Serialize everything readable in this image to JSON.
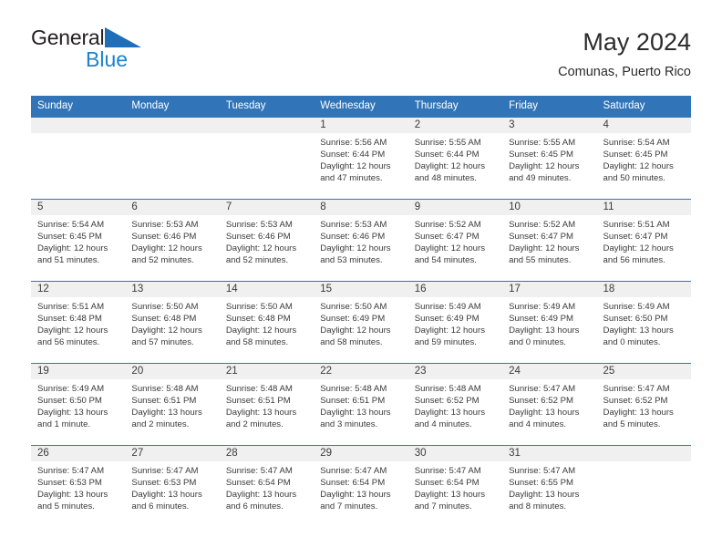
{
  "brand": {
    "name_top": "General",
    "name_bottom": "Blue",
    "triangle_color": "#1e6fb8",
    "text_color": "#231f20",
    "blue_color": "#2181c9"
  },
  "header": {
    "title": "May 2024",
    "subtitle": "Comunas, Puerto Rico"
  },
  "theme": {
    "header_blue": "#3175b8",
    "day_band_gray": "#f0f0f0",
    "text": "#3a3a3a"
  },
  "weekdays": [
    "Sunday",
    "Monday",
    "Tuesday",
    "Wednesday",
    "Thursday",
    "Friday",
    "Saturday"
  ],
  "weeks": [
    [
      {
        "day": "",
        "sunrise": "",
        "sunset": "",
        "daylight_line1": "",
        "daylight_line2": ""
      },
      {
        "day": "",
        "sunrise": "",
        "sunset": "",
        "daylight_line1": "",
        "daylight_line2": ""
      },
      {
        "day": "",
        "sunrise": "",
        "sunset": "",
        "daylight_line1": "",
        "daylight_line2": ""
      },
      {
        "day": "1",
        "sunrise": "Sunrise: 5:56 AM",
        "sunset": "Sunset: 6:44 PM",
        "daylight_line1": "Daylight: 12 hours",
        "daylight_line2": "and 47 minutes."
      },
      {
        "day": "2",
        "sunrise": "Sunrise: 5:55 AM",
        "sunset": "Sunset: 6:44 PM",
        "daylight_line1": "Daylight: 12 hours",
        "daylight_line2": "and 48 minutes."
      },
      {
        "day": "3",
        "sunrise": "Sunrise: 5:55 AM",
        "sunset": "Sunset: 6:45 PM",
        "daylight_line1": "Daylight: 12 hours",
        "daylight_line2": "and 49 minutes."
      },
      {
        "day": "4",
        "sunrise": "Sunrise: 5:54 AM",
        "sunset": "Sunset: 6:45 PM",
        "daylight_line1": "Daylight: 12 hours",
        "daylight_line2": "and 50 minutes."
      }
    ],
    [
      {
        "day": "5",
        "sunrise": "Sunrise: 5:54 AM",
        "sunset": "Sunset: 6:45 PM",
        "daylight_line1": "Daylight: 12 hours",
        "daylight_line2": "and 51 minutes."
      },
      {
        "day": "6",
        "sunrise": "Sunrise: 5:53 AM",
        "sunset": "Sunset: 6:46 PM",
        "daylight_line1": "Daylight: 12 hours",
        "daylight_line2": "and 52 minutes."
      },
      {
        "day": "7",
        "sunrise": "Sunrise: 5:53 AM",
        "sunset": "Sunset: 6:46 PM",
        "daylight_line1": "Daylight: 12 hours",
        "daylight_line2": "and 52 minutes."
      },
      {
        "day": "8",
        "sunrise": "Sunrise: 5:53 AM",
        "sunset": "Sunset: 6:46 PM",
        "daylight_line1": "Daylight: 12 hours",
        "daylight_line2": "and 53 minutes."
      },
      {
        "day": "9",
        "sunrise": "Sunrise: 5:52 AM",
        "sunset": "Sunset: 6:47 PM",
        "daylight_line1": "Daylight: 12 hours",
        "daylight_line2": "and 54 minutes."
      },
      {
        "day": "10",
        "sunrise": "Sunrise: 5:52 AM",
        "sunset": "Sunset: 6:47 PM",
        "daylight_line1": "Daylight: 12 hours",
        "daylight_line2": "and 55 minutes."
      },
      {
        "day": "11",
        "sunrise": "Sunrise: 5:51 AM",
        "sunset": "Sunset: 6:47 PM",
        "daylight_line1": "Daylight: 12 hours",
        "daylight_line2": "and 56 minutes."
      }
    ],
    [
      {
        "day": "12",
        "sunrise": "Sunrise: 5:51 AM",
        "sunset": "Sunset: 6:48 PM",
        "daylight_line1": "Daylight: 12 hours",
        "daylight_line2": "and 56 minutes."
      },
      {
        "day": "13",
        "sunrise": "Sunrise: 5:50 AM",
        "sunset": "Sunset: 6:48 PM",
        "daylight_line1": "Daylight: 12 hours",
        "daylight_line2": "and 57 minutes."
      },
      {
        "day": "14",
        "sunrise": "Sunrise: 5:50 AM",
        "sunset": "Sunset: 6:48 PM",
        "daylight_line1": "Daylight: 12 hours",
        "daylight_line2": "and 58 minutes."
      },
      {
        "day": "15",
        "sunrise": "Sunrise: 5:50 AM",
        "sunset": "Sunset: 6:49 PM",
        "daylight_line1": "Daylight: 12 hours",
        "daylight_line2": "and 58 minutes."
      },
      {
        "day": "16",
        "sunrise": "Sunrise: 5:49 AM",
        "sunset": "Sunset: 6:49 PM",
        "daylight_line1": "Daylight: 12 hours",
        "daylight_line2": "and 59 minutes."
      },
      {
        "day": "17",
        "sunrise": "Sunrise: 5:49 AM",
        "sunset": "Sunset: 6:49 PM",
        "daylight_line1": "Daylight: 13 hours",
        "daylight_line2": "and 0 minutes."
      },
      {
        "day": "18",
        "sunrise": "Sunrise: 5:49 AM",
        "sunset": "Sunset: 6:50 PM",
        "daylight_line1": "Daylight: 13 hours",
        "daylight_line2": "and 0 minutes."
      }
    ],
    [
      {
        "day": "19",
        "sunrise": "Sunrise: 5:49 AM",
        "sunset": "Sunset: 6:50 PM",
        "daylight_line1": "Daylight: 13 hours",
        "daylight_line2": "and 1 minute."
      },
      {
        "day": "20",
        "sunrise": "Sunrise: 5:48 AM",
        "sunset": "Sunset: 6:51 PM",
        "daylight_line1": "Daylight: 13 hours",
        "daylight_line2": "and 2 minutes."
      },
      {
        "day": "21",
        "sunrise": "Sunrise: 5:48 AM",
        "sunset": "Sunset: 6:51 PM",
        "daylight_line1": "Daylight: 13 hours",
        "daylight_line2": "and 2 minutes."
      },
      {
        "day": "22",
        "sunrise": "Sunrise: 5:48 AM",
        "sunset": "Sunset: 6:51 PM",
        "daylight_line1": "Daylight: 13 hours",
        "daylight_line2": "and 3 minutes."
      },
      {
        "day": "23",
        "sunrise": "Sunrise: 5:48 AM",
        "sunset": "Sunset: 6:52 PM",
        "daylight_line1": "Daylight: 13 hours",
        "daylight_line2": "and 4 minutes."
      },
      {
        "day": "24",
        "sunrise": "Sunrise: 5:47 AM",
        "sunset": "Sunset: 6:52 PM",
        "daylight_line1": "Daylight: 13 hours",
        "daylight_line2": "and 4 minutes."
      },
      {
        "day": "25",
        "sunrise": "Sunrise: 5:47 AM",
        "sunset": "Sunset: 6:52 PM",
        "daylight_line1": "Daylight: 13 hours",
        "daylight_line2": "and 5 minutes."
      }
    ],
    [
      {
        "day": "26",
        "sunrise": "Sunrise: 5:47 AM",
        "sunset": "Sunset: 6:53 PM",
        "daylight_line1": "Daylight: 13 hours",
        "daylight_line2": "and 5 minutes."
      },
      {
        "day": "27",
        "sunrise": "Sunrise: 5:47 AM",
        "sunset": "Sunset: 6:53 PM",
        "daylight_line1": "Daylight: 13 hours",
        "daylight_line2": "and 6 minutes."
      },
      {
        "day": "28",
        "sunrise": "Sunrise: 5:47 AM",
        "sunset": "Sunset: 6:54 PM",
        "daylight_line1": "Daylight: 13 hours",
        "daylight_line2": "and 6 minutes."
      },
      {
        "day": "29",
        "sunrise": "Sunrise: 5:47 AM",
        "sunset": "Sunset: 6:54 PM",
        "daylight_line1": "Daylight: 13 hours",
        "daylight_line2": "and 7 minutes."
      },
      {
        "day": "30",
        "sunrise": "Sunrise: 5:47 AM",
        "sunset": "Sunset: 6:54 PM",
        "daylight_line1": "Daylight: 13 hours",
        "daylight_line2": "and 7 minutes."
      },
      {
        "day": "31",
        "sunrise": "Sunrise: 5:47 AM",
        "sunset": "Sunset: 6:55 PM",
        "daylight_line1": "Daylight: 13 hours",
        "daylight_line2": "and 8 minutes."
      },
      {
        "day": "",
        "sunrise": "",
        "sunset": "",
        "daylight_line1": "",
        "daylight_line2": ""
      }
    ]
  ]
}
